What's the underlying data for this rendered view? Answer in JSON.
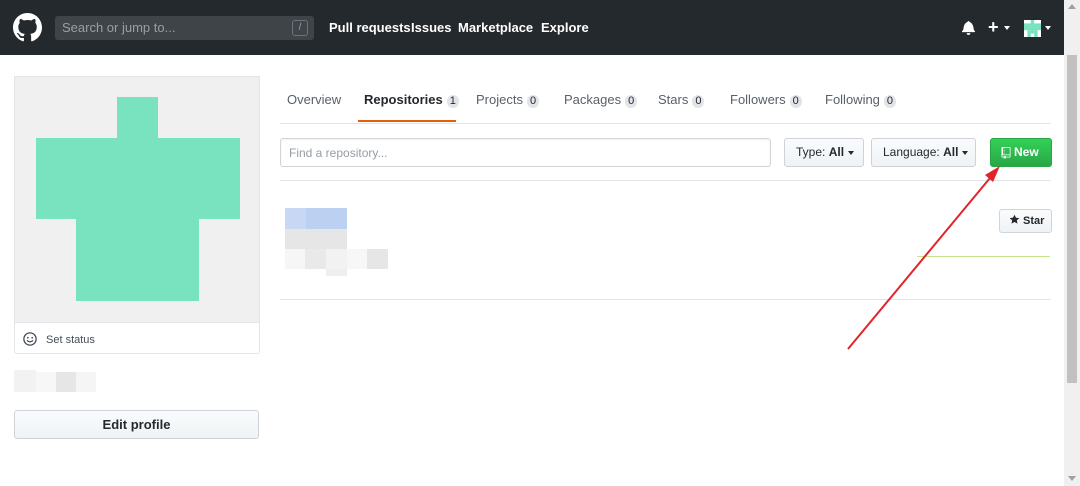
{
  "header": {
    "search_placeholder": "Search or jump to...",
    "search_shortcut": "/",
    "nav": [
      "Pull requests",
      "Issues",
      "Marketplace",
      "Explore"
    ],
    "plus_label": "+"
  },
  "profile": {
    "set_status": "Set status",
    "edit_profile": "Edit profile",
    "avatar_color": "#79e2bf"
  },
  "tabs": [
    {
      "label": "Overview"
    },
    {
      "label": "Repositories",
      "count": "1",
      "selected": true
    },
    {
      "label": "Projects",
      "count": "0"
    },
    {
      "label": "Packages",
      "count": "0"
    },
    {
      "label": "Stars",
      "count": "0"
    },
    {
      "label": "Followers",
      "count": "0"
    },
    {
      "label": "Following",
      "count": "0"
    }
  ],
  "filters": {
    "find_placeholder": "Find a repository...",
    "type_label": "Type:",
    "type_value": "All",
    "language_label": "Language:",
    "language_value": "All",
    "new_label": "New"
  },
  "repo": {
    "star_label": "Star"
  },
  "colors": {
    "header_bg": "#24292e",
    "new_button": "#2cbe4e",
    "tab_underline": "#e36209",
    "annotation_arrow": "#e0242b"
  }
}
